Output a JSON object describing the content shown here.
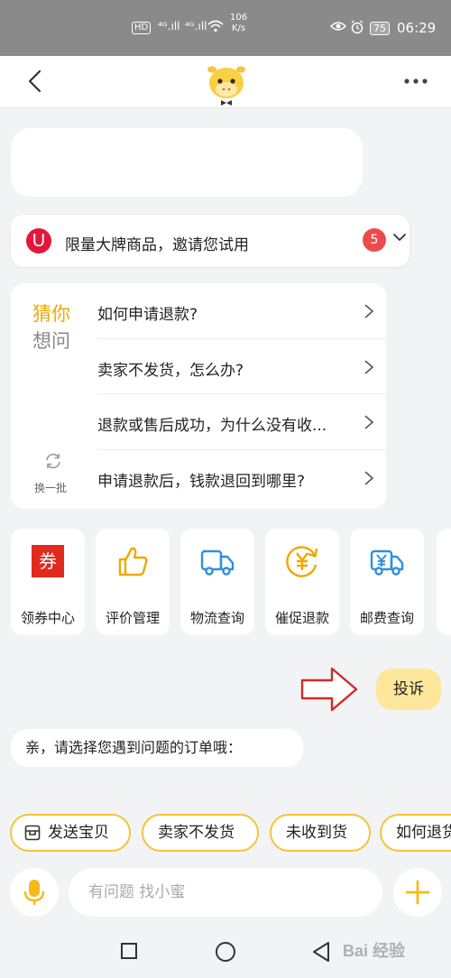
{
  "status_bar": {
    "hd": "HD",
    "signal_1": "⁴ᴳ.ıll",
    "signal_2": "⁴ᴳ.ıll",
    "speed_value": "106",
    "speed_unit": "K/s",
    "battery": "75",
    "time": "06:29"
  },
  "header": {
    "back_icon": "chevron-left-icon",
    "mascot": "yellow-calf-mascot",
    "more_icon": "more-dots-icon"
  },
  "promo": {
    "logo": "U",
    "text": "限量大牌商品，邀请您试用",
    "badge": "5"
  },
  "faq": {
    "title_line1": "猜你",
    "title_line2": "想问",
    "refresh_label": "换一批",
    "questions": [
      "如何申请退款?",
      "卖家不发货，怎么办?",
      "退款或售后成功，为什么没有收...",
      "申请退款后，钱款退回到哪里?"
    ]
  },
  "services": [
    {
      "label": "领券中心",
      "icon": "coupon-icon",
      "glyph": "券"
    },
    {
      "label": "评价管理",
      "icon": "thumbs-up-icon"
    },
    {
      "label": "物流查询",
      "icon": "truck-icon"
    },
    {
      "label": "催促退款",
      "icon": "yen-refresh-icon"
    },
    {
      "label": "邮费查询",
      "icon": "yen-truck-icon"
    }
  ],
  "chat": {
    "user_message": "投诉",
    "bot_message": "亲，请选择您遇到问题的订单哦："
  },
  "quick_replies": [
    {
      "label": "发送宝贝",
      "icon": "package-icon"
    },
    {
      "label": "卖家不发货"
    },
    {
      "label": "未收到货"
    },
    {
      "label": "如何退货"
    }
  ],
  "input": {
    "placeholder": "有问题 找小蜜"
  },
  "watermark": "Bai 经验",
  "colors": {
    "accent_yellow": "#f5c33b",
    "faq_title": "#f0a800",
    "badge_red": "#ec4b4b",
    "complaint_bubble": "#fde79a",
    "icon_blue": "#2f8fe0"
  }
}
